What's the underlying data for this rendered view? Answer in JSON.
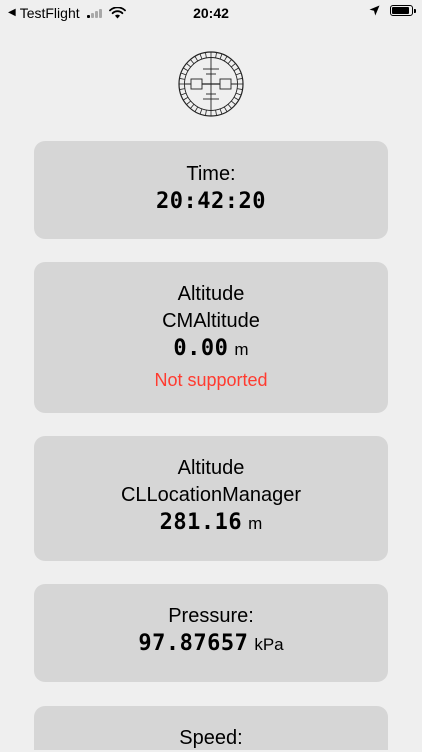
{
  "status_bar": {
    "back_app": "TestFlight",
    "time": "20:42",
    "icons": [
      "back-caret-icon",
      "cellular-signal-icon",
      "wifi-icon",
      "location-arrow-icon",
      "battery-icon"
    ],
    "battery_level": 0.92
  },
  "logo": {
    "icon": "barometer-dial-icon"
  },
  "cards": {
    "time": {
      "label": "Time:",
      "value": "20:42:20"
    },
    "cm_altitude": {
      "label_line1": "Altitude",
      "label_line2": "CMAltitude",
      "value": "0.00",
      "unit": "m",
      "status": "Not supported",
      "status_color": "#ff3b30"
    },
    "cl_altitude": {
      "label_line1": "Altitude",
      "label_line2": "CLLocationManager",
      "value": "281.16",
      "unit": "m"
    },
    "pressure": {
      "label": "Pressure:",
      "value": "97.87657",
      "unit": "kPa"
    },
    "speed": {
      "label": "Speed:"
    }
  },
  "colors": {
    "background": "#efefef",
    "card": "#d6d6d6",
    "error": "#ff3b30"
  }
}
